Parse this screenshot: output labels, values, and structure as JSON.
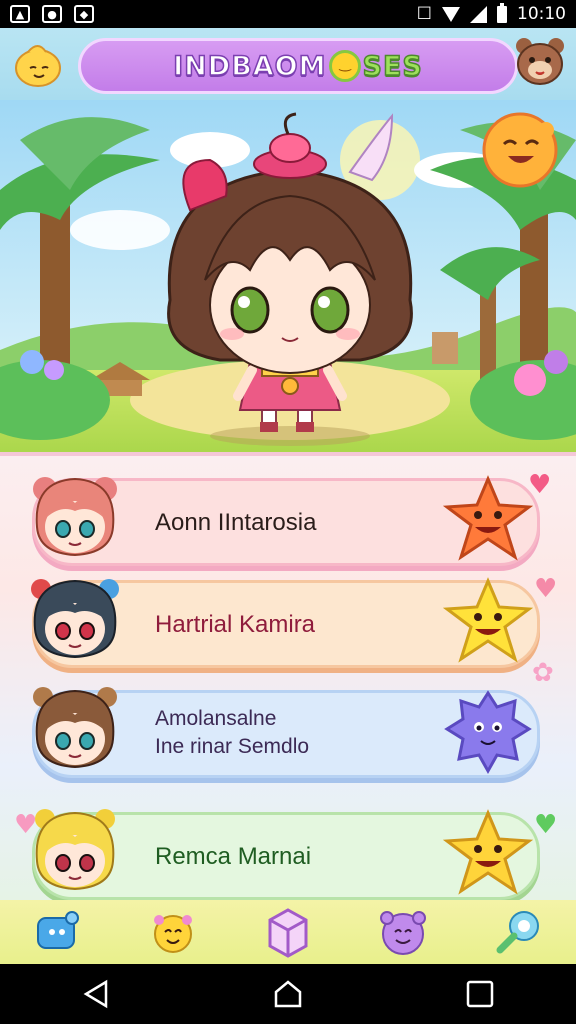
{
  "status_bar": {
    "time": "10:10",
    "left_icons": [
      "image-icon",
      "photo-icon",
      "app-icon"
    ],
    "right_icons": [
      "vibrate-icon",
      "wifi-icon",
      "signal-icon",
      "battery-icon"
    ]
  },
  "header": {
    "title": "INDBAOM",
    "title_suffix": "SES",
    "left_icon": "yellow-mascot-icon",
    "right_icon": "bear-mascot-icon"
  },
  "hero": {
    "character": "brown-haired chibi girl",
    "corner_icon": "smiling-sun-icon"
  },
  "characters": [
    {
      "name_line1": "Aonn IIntarosia",
      "name_line2": "",
      "name_color": "#2a1d1a",
      "mascot": "orange-star-mascot",
      "heart_color": "#f35b86"
    },
    {
      "name_line1": "Hartrial Kamira",
      "name_line2": "",
      "name_color": "#8f1c3c",
      "mascot": "yellow-star-mascot",
      "heart_color": "#f58aa8"
    },
    {
      "name_line1": "Amolansalne",
      "name_line2": "Ine rinar Semdlo",
      "name_color": "#3c2a55",
      "mascot": "purple-blob-mascot",
      "heart_color": "#f7a3c7"
    },
    {
      "name_line1": "Remca Marnai",
      "name_line2": "",
      "name_color": "#1f5d22",
      "mascot": "yellow-star-mascot-2",
      "heart_color": "#5fcb5f"
    }
  ],
  "bottom_nav": [
    "chat-icon",
    "mascot-icon",
    "box-icon",
    "monster-icon",
    "tool-icon"
  ],
  "system_nav": [
    "back-icon",
    "home-icon",
    "recents-icon"
  ],
  "colors": {
    "accent_purple": "#c37de9",
    "header_blue": "#a8dcef",
    "nav_yellow": "#e8f08c"
  }
}
